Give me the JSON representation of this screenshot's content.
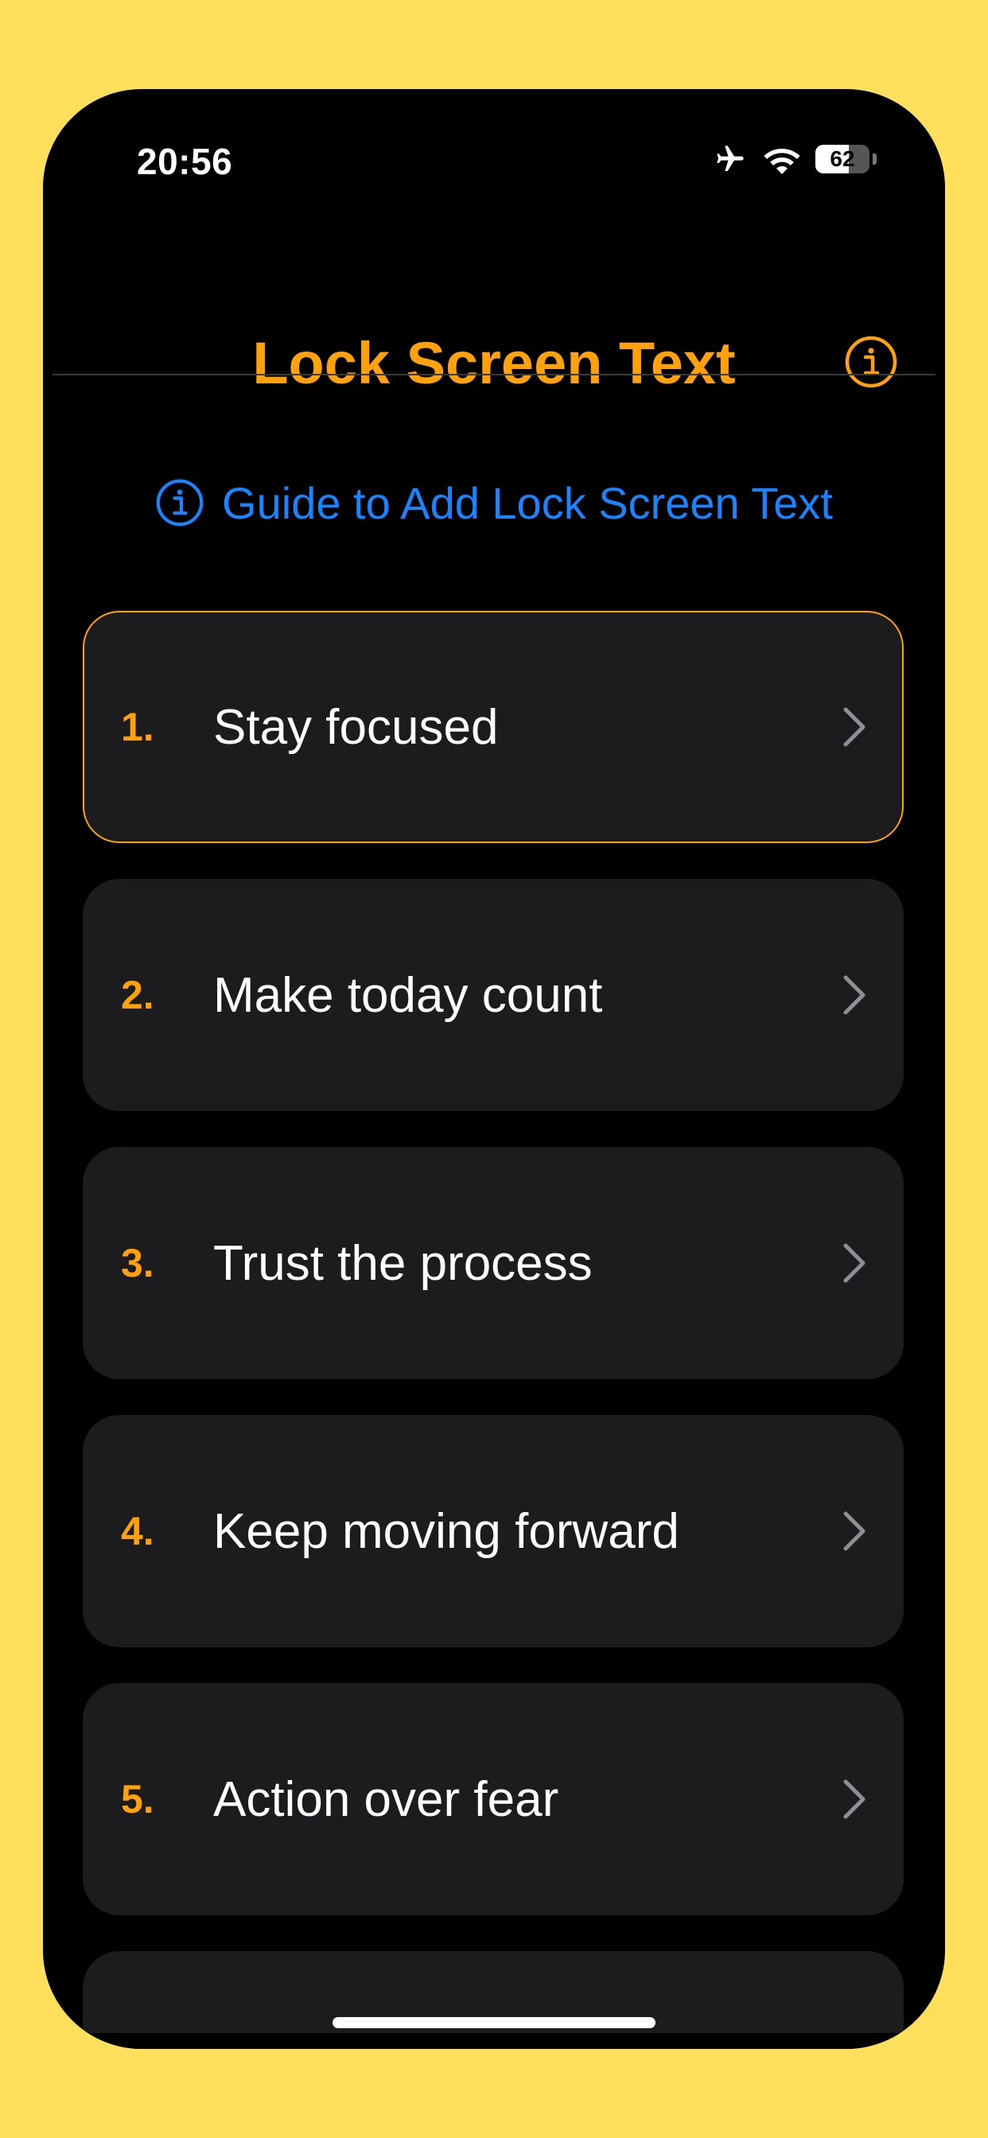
{
  "status_bar": {
    "time": "20:56",
    "battery_level": "62",
    "battery_fraction": 0.62,
    "icons": [
      "airplane-icon",
      "wifi-icon",
      "battery-icon"
    ]
  },
  "header": {
    "title": "Lock Screen Text",
    "info_icon": "info-circle-icon"
  },
  "guide": {
    "label": "Guide to Add Lock Screen Text",
    "icon": "info-circle-icon"
  },
  "items": [
    {
      "number": "1.",
      "text": "Stay focused",
      "selected": true
    },
    {
      "number": "2.",
      "text": "Make today count",
      "selected": false
    },
    {
      "number": "3.",
      "text": "Trust the process",
      "selected": false
    },
    {
      "number": "4.",
      "text": "Keep moving forward",
      "selected": false
    },
    {
      "number": "5.",
      "text": "Action over fear",
      "selected": false
    },
    {
      "number": "",
      "text": "",
      "selected": false
    }
  ],
  "colors": {
    "background": "#FFDF5C",
    "accent": "#FFA10A",
    "link": "#1A84FF",
    "card": "#1C1C1E"
  }
}
